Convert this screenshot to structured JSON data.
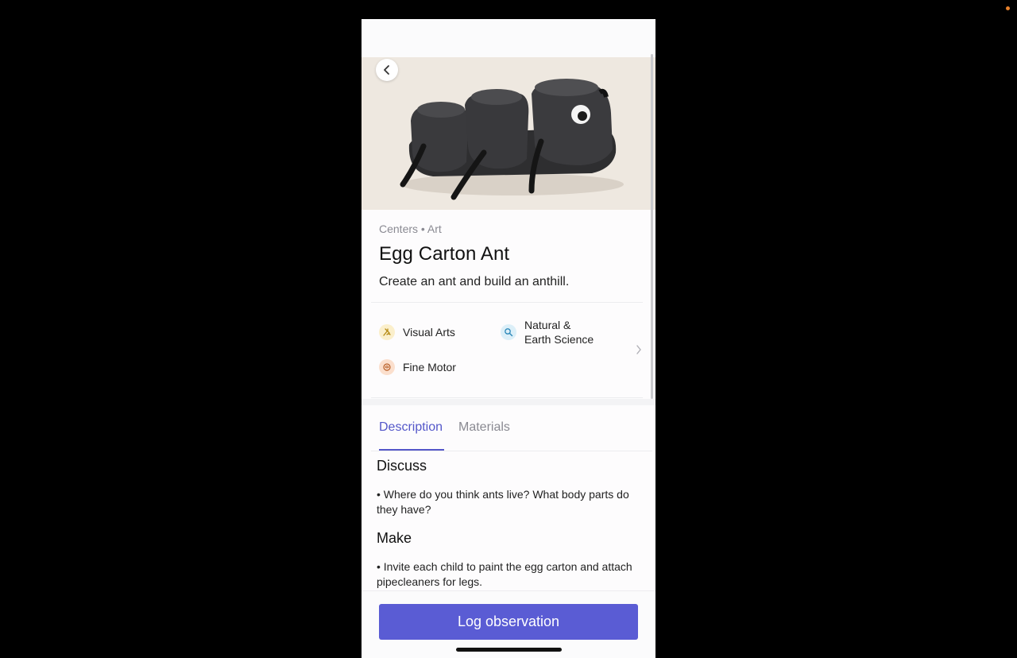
{
  "activity": {
    "breadcrumb": "Centers • Art",
    "title": "Egg Carton Ant",
    "subtitle": "Create an ant and build an anthill."
  },
  "domains": [
    {
      "label": "Visual Arts",
      "icon": "palette-icon",
      "color": "#e6b52e"
    },
    {
      "label": "Natural &",
      "label_line2": "Earth Science",
      "icon": "magnifier-icon",
      "color": "#3a9fd0"
    },
    {
      "label": "Fine Motor",
      "icon": "hand-icon",
      "color": "#d9763a"
    }
  ],
  "tabs": [
    {
      "label": "Description",
      "active": true
    },
    {
      "label": "Materials",
      "active": false
    }
  ],
  "description": {
    "sections": [
      {
        "heading": "Discuss",
        "bullet": "• Where do you think ants live? What body parts do they have?"
      },
      {
        "heading": "Make",
        "bullet": "• Invite each child to paint the egg carton and attach pipecleaners for legs."
      }
    ]
  },
  "footer": {
    "button_label": "Log observation"
  },
  "colors": {
    "accent": "#5457c9",
    "button": "#5a5cd4",
    "background": "#000000"
  }
}
